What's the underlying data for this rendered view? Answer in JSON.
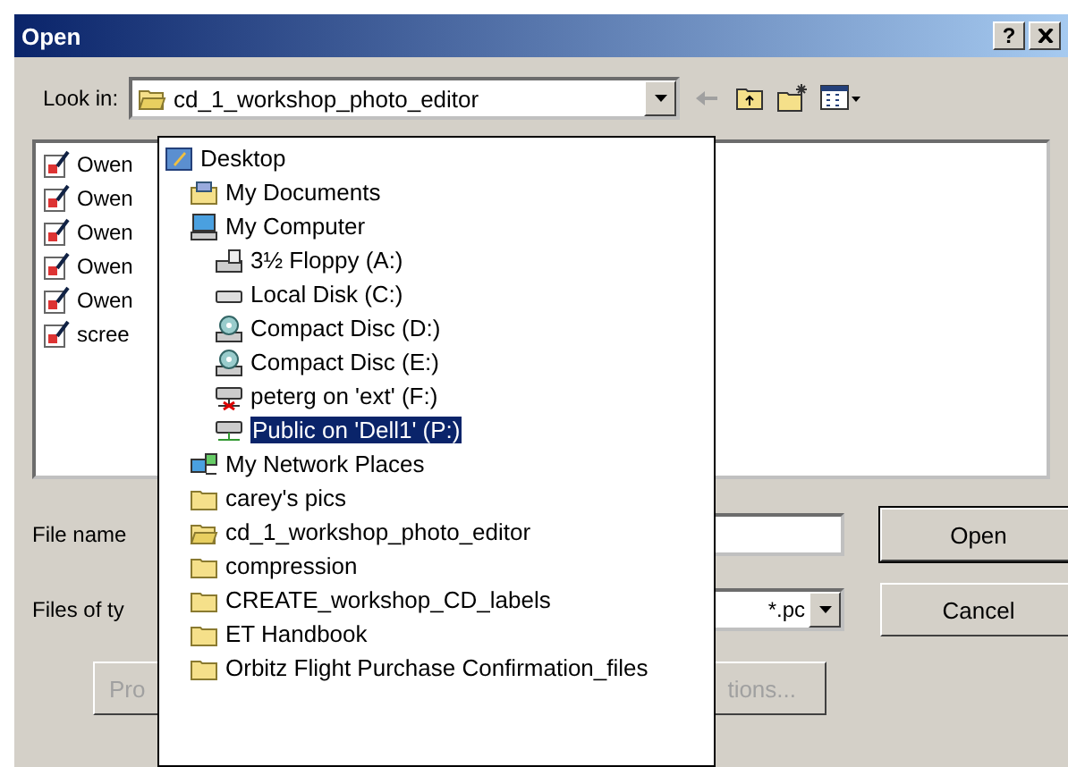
{
  "window": {
    "title": "Open",
    "help_button": "?"
  },
  "look_in": {
    "label": "Look in:",
    "value": "cd_1_workshop_photo_editor"
  },
  "files": [
    {
      "name": "Owen"
    },
    {
      "name": "Owen"
    },
    {
      "name": "Owen"
    },
    {
      "name": "Owen"
    },
    {
      "name": "Owen"
    },
    {
      "name": "scree"
    }
  ],
  "location_list": [
    {
      "name": "Desktop",
      "kind": "desktop",
      "selected": false,
      "children": [
        {
          "name": "My Documents",
          "kind": "documents",
          "selected": false
        },
        {
          "name": "My Computer",
          "kind": "computer",
          "selected": false,
          "children": [
            {
              "name": "3½ Floppy (A:)",
              "kind": "floppy",
              "selected": false
            },
            {
              "name": "Local Disk (C:)",
              "kind": "disk",
              "selected": false
            },
            {
              "name": "Compact Disc (D:)",
              "kind": "cd",
              "selected": false
            },
            {
              "name": "Compact Disc (E:)",
              "kind": "cd",
              "selected": false
            },
            {
              "name": "peterg on 'ext' (F:)",
              "kind": "netdrive-off",
              "selected": false
            },
            {
              "name": "Public on 'Dell1' (P:)",
              "kind": "netdrive",
              "selected": true
            }
          ]
        },
        {
          "name": "My Network Places",
          "kind": "network",
          "selected": false
        },
        {
          "name": "carey's pics",
          "kind": "folder",
          "selected": false
        },
        {
          "name": "cd_1_workshop_photo_editor",
          "kind": "folder-open",
          "selected": false
        },
        {
          "name": "compression",
          "kind": "folder",
          "selected": false
        },
        {
          "name": "CREATE_workshop_CD_labels",
          "kind": "folder",
          "selected": false
        },
        {
          "name": "ET Handbook",
          "kind": "folder",
          "selected": false
        },
        {
          "name": "Orbitz Flight Purchase Confirmation_files",
          "kind": "folder",
          "selected": false
        }
      ]
    }
  ],
  "file_name": {
    "label": "File name"
  },
  "file_type": {
    "label": "Files of ty",
    "value": "*.pc"
  },
  "buttons": [
    {
      "label": "Open",
      "default": true
    },
    {
      "label": "Cancel",
      "default": false
    }
  ],
  "lower_buttons": [
    {
      "label": "Pro",
      "disabled": true
    },
    {
      "label": "tions...",
      "disabled": true
    }
  ]
}
